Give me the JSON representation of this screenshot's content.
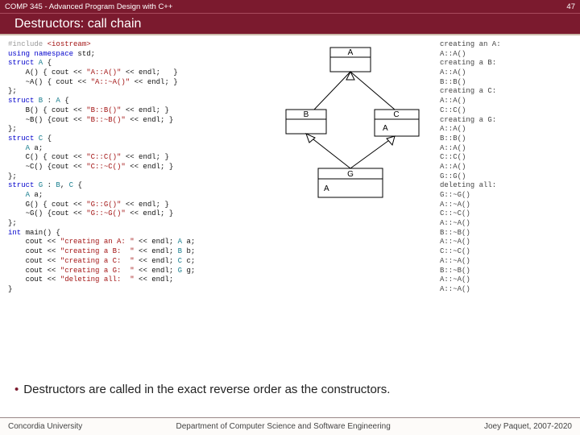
{
  "header": {
    "course": "COMP 345 - Advanced Program Design with C++",
    "page_number": "47",
    "slide_title": "Destructors: call chain"
  },
  "code": {
    "pp_include": "#include",
    "pp_header": " <iostream>",
    "kw_using": "using",
    "kw_namespace": " namespace",
    "ns_std": " std;",
    "kw_struct": "struct",
    "tp_A": " A",
    "brace_open": " {",
    "A_ctor_sig": "    A() { cout << ",
    "A_ctor_str": "\"A::A()\"",
    "endl_brC": " << endl;   }",
    "A_dtor_sig": "    ~A() { cout << ",
    "A_dtor_str": "\"A::~A()\"",
    "endl_br": " << endl; }",
    "close_struct": "};",
    "tp_B": " B",
    "B_inherit": " : ",
    "B_base": "A",
    "B_ctor_sig": "    B() { cout << ",
    "B_ctor_str": "\"B::B()\"",
    "B_dtor_sig": "    ~B() {cout << ",
    "B_dtor_str": "\"B::~B()\"",
    "tp_C": " C",
    "C_member": "    A a;",
    "C_ctor_sig": "    C() { cout << ",
    "C_ctor_str": "\"C::C()\"",
    "C_dtor_sig": "    ~C() {cout << ",
    "C_dtor_str": "\"C::~C()\"",
    "tp_G": " G",
    "G_inherit": " : ",
    "G_base1": "B",
    "G_comma": ", ",
    "G_base2": "C",
    "G_member": "    A a;",
    "G_ctor_sig": "    G() { cout << ",
    "G_ctor_str": "\"G::G()\"",
    "G_dtor_sig": "    ~G() {cout << ",
    "G_dtor_str": "\"G::~G()\"",
    "kw_int": "int",
    "main_sig": " main() {",
    "ln_a_pre": "    cout << ",
    "str_creating_a": "\"creating an A: \"",
    "ln_a_post": " << endl; ",
    "decl_a": " a;",
    "str_creating_b": "\"creating a B:  \"",
    "decl_b": " b;",
    "str_creating_c": "\"creating a C:  \"",
    "decl_c": " c;",
    "str_creating_g": "\"creating a G:  \"",
    "decl_g": " g;",
    "str_deleting": "\"deleting all:  \"",
    "ln_del_post": " << endl;",
    "main_close": "}"
  },
  "output": {
    "text": "creating an A:\nA::A()\ncreating a B:\nA::A()\nB::B()\ncreating a C:\nA::A()\nC::C()\ncreating a G:\nA::A()\nB::B()\nA::A()\nC::C()\nA::A()\nG::G()\ndeleting all:\nG::~G()\nA::~A()\nC::~C()\nA::~A()\nB::~B()\nA::~A()\nC::~C()\nA::~A()\nB::~B()\nA::~A()\nA::~A()"
  },
  "diagram": {
    "label_A": "A",
    "label_B": "B",
    "label_C": "C",
    "label_G": "G",
    "member_A1": "A",
    "member_A2": "A"
  },
  "bullet": {
    "text": "Destructors are called in the exact reverse order as the constructors."
  },
  "footer": {
    "left": "Concordia University",
    "center": "Department of Computer Science and Software Engineering",
    "right": "Joey Paquet, 2007-2020"
  }
}
